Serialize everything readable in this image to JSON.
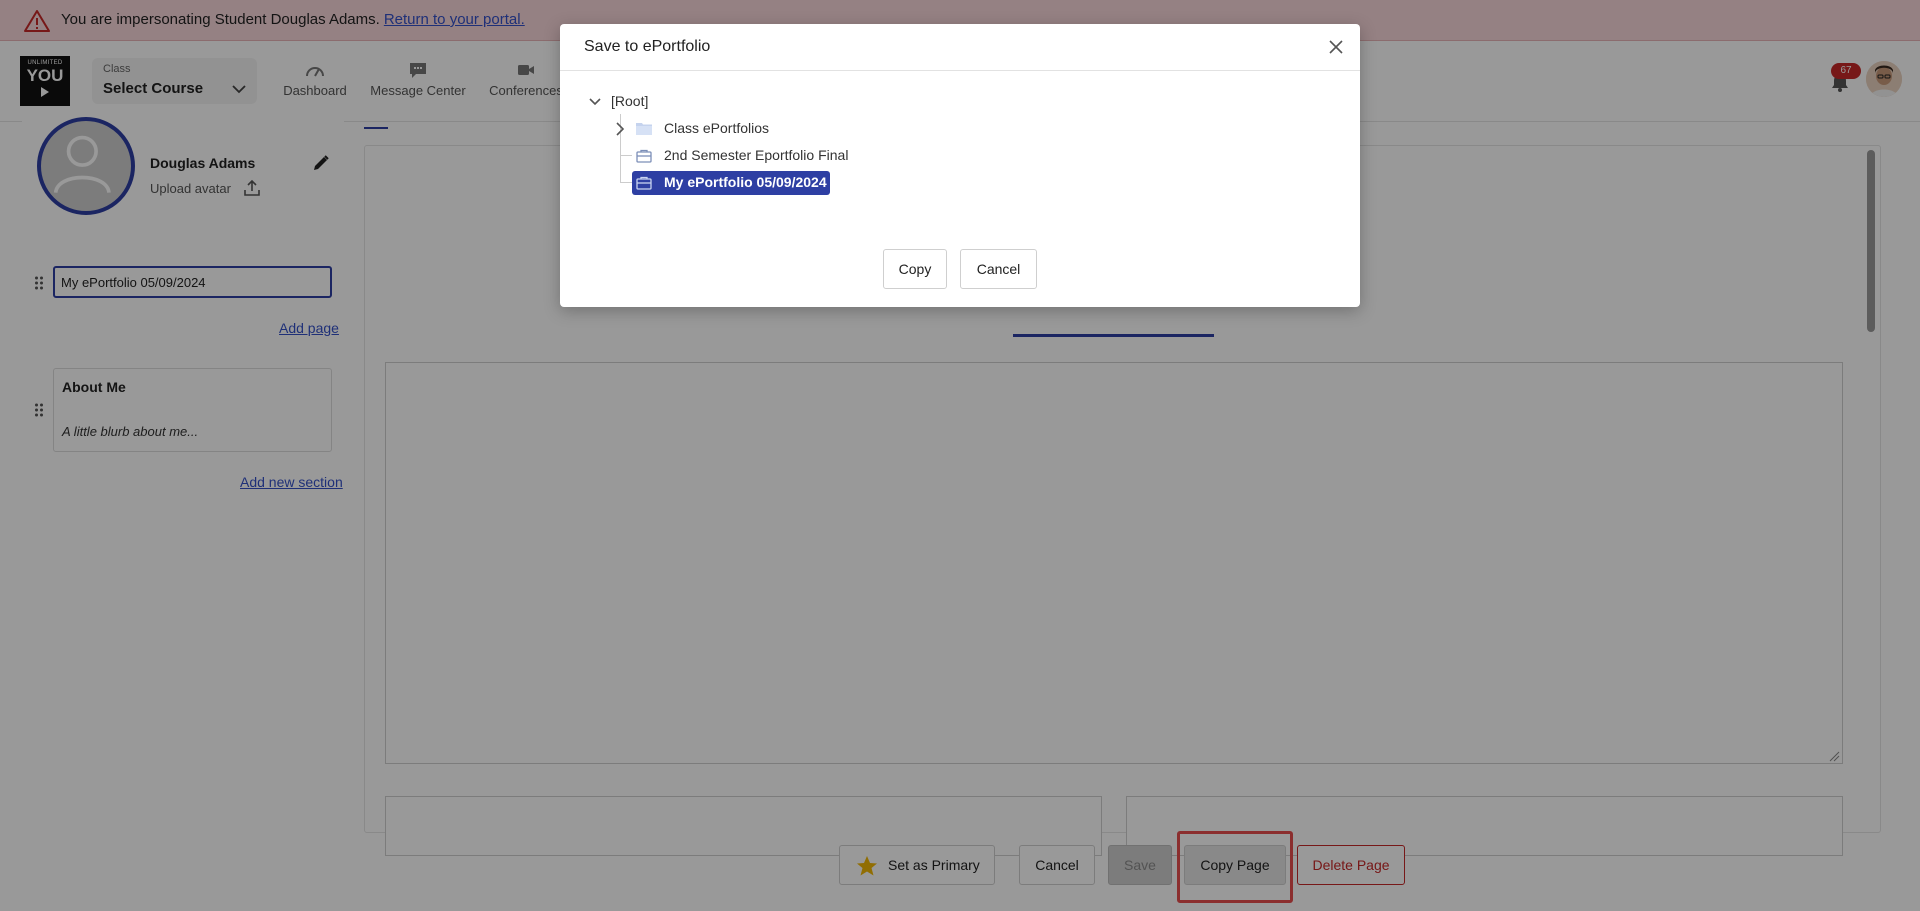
{
  "banner": {
    "message": "You are impersonating Student Douglas Adams.",
    "link": "Return to your portal."
  },
  "header": {
    "logo": {
      "line1": "UNLIMITED",
      "line2": "YOU"
    },
    "class_selector": {
      "label": "Class",
      "value": "Select Course"
    },
    "nav": [
      {
        "label": "Dashboard",
        "icon": "gauge-icon"
      },
      {
        "label": "Message Center",
        "icon": "chat-bubble-icon"
      },
      {
        "label": "Conferences",
        "icon": "video-camera-icon"
      }
    ],
    "notifications": {
      "count": "67"
    }
  },
  "profile": {
    "name": "Douglas Adams",
    "upload_label": "Upload avatar"
  },
  "pages": {
    "current_page_title": "My ePortfolio 05/09/2024",
    "add_page": "Add page"
  },
  "sections": {
    "items": [
      {
        "title": "About Me",
        "description": "A little blurb about me..."
      }
    ],
    "add_section": "Add new section"
  },
  "actions": {
    "set_primary": "Set as Primary",
    "cancel": "Cancel",
    "save": "Save",
    "copy_page": "Copy Page",
    "delete_page": "Delete Page"
  },
  "dialog": {
    "title": "Save to ePortfolio",
    "tree": {
      "root": "[Root]",
      "children": [
        {
          "label": "Class ePortfolios",
          "type": "folder",
          "expandable": true,
          "selected": false
        },
        {
          "label": "2nd Semester Eportfolio Final",
          "type": "portfolio",
          "expandable": false,
          "selected": false
        },
        {
          "label": "My ePortfolio 05/09/2024",
          "type": "portfolio",
          "expandable": false,
          "selected": true
        }
      ]
    },
    "copy_button": "Copy",
    "cancel_button": "Cancel"
  },
  "colors": {
    "accent": "#2e3fa3",
    "danger": "#c62828",
    "banner_bg": "#f8d7da",
    "highlight": "#e84e4e"
  }
}
